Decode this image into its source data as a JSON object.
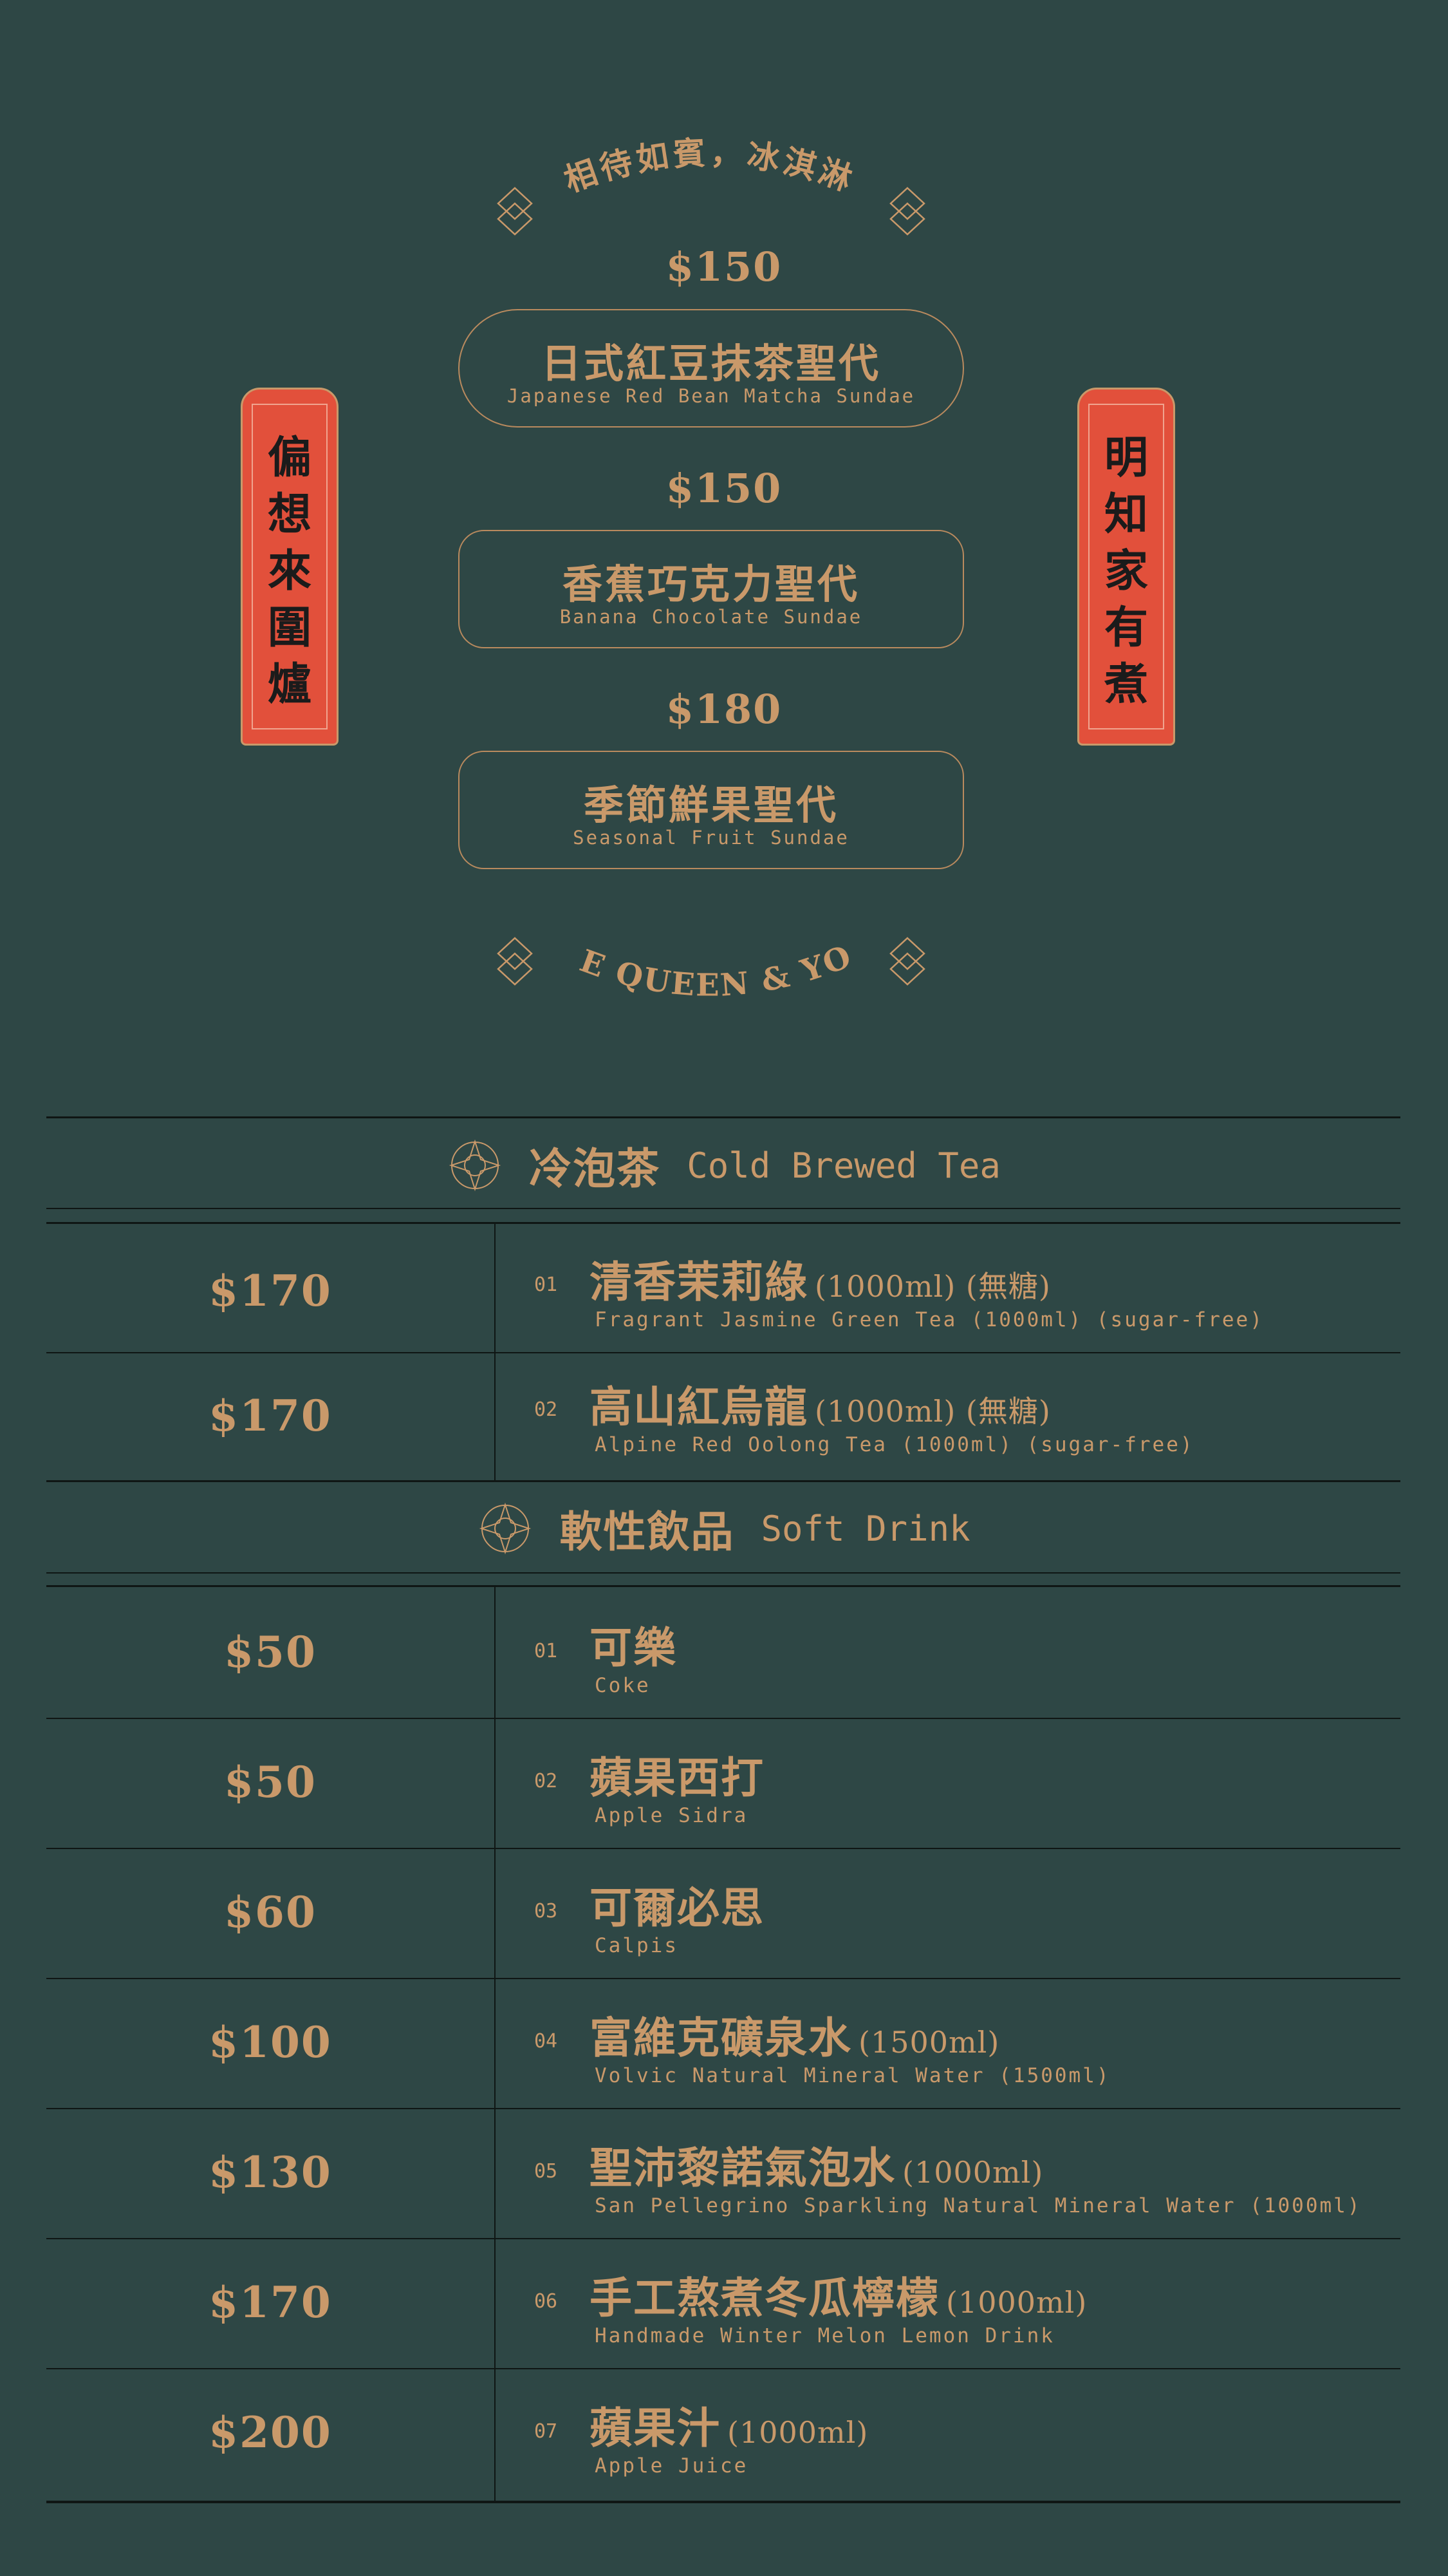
{
  "header": {
    "arc_top": "相待如賓，冰淇淋",
    "arc_bottom": "ICE QUEEN & YOU"
  },
  "couplet": {
    "left": [
      "偏",
      "想",
      "來",
      "圍",
      "爐"
    ],
    "right": [
      "明",
      "知",
      "家",
      "有",
      "煮"
    ]
  },
  "sundaes": [
    {
      "price": "$150",
      "zh": "日式紅豆抹茶聖代",
      "en": "Japanese Red Bean Matcha Sundae"
    },
    {
      "price": "$150",
      "zh": "香蕉巧克力聖代",
      "en": "Banana Chocolate Sundae"
    },
    {
      "price": "$180",
      "zh": "季節鮮果聖代",
      "en": "Seasonal Fruit Sundae"
    }
  ],
  "sections": [
    {
      "zh": "冷泡茶",
      "en": "Cold Brewed Tea",
      "items": [
        {
          "price": "$170",
          "num": "01",
          "zh": "清香茉莉綠",
          "extra": "(1000ml) (無糖)",
          "en": "Fragrant Jasmine Green Tea (1000ml) (sugar-free)"
        },
        {
          "price": "$170",
          "num": "02",
          "zh": "高山紅烏龍",
          "extra": "(1000ml) (無糖)",
          "en": "Alpine Red Oolong Tea (1000ml) (sugar-free)"
        }
      ]
    },
    {
      "zh": "軟性飲品",
      "en": "Soft Drink",
      "items": [
        {
          "price": "$50",
          "num": "01",
          "zh": "可樂",
          "extra": "",
          "en": "Coke"
        },
        {
          "price": "$50",
          "num": "02",
          "zh": "蘋果西打",
          "extra": "",
          "en": "Apple Sidra"
        },
        {
          "price": "$60",
          "num": "03",
          "zh": "可爾必思",
          "extra": "",
          "en": "Calpis"
        },
        {
          "price": "$100",
          "num": "04",
          "zh": "富維克礦泉水",
          "extra": "(1500ml)",
          "en": "Volvic Natural Mineral Water (1500ml)"
        },
        {
          "price": "$130",
          "num": "05",
          "zh": "聖沛黎諾氣泡水",
          "extra": "(1000ml)",
          "en": "San Pellegrino Sparkling Natural Mineral Water (1000ml)"
        },
        {
          "price": "$170",
          "num": "06",
          "zh": "手工熬煮冬瓜檸檬",
          "extra": "(1000ml)",
          "en": "Handmade Winter Melon Lemon Drink"
        },
        {
          "price": "$200",
          "num": "07",
          "zh": "蘋果汁",
          "extra": "(1000ml)",
          "en": "Apple Juice"
        }
      ]
    }
  ],
  "colors": {
    "background": "#2e4745",
    "gold": "#c9996a",
    "banner_red": "#e2503b",
    "rule": "#0f1614"
  },
  "icons": [
    "diamond-ornament-icon",
    "compass-ornament-icon"
  ]
}
